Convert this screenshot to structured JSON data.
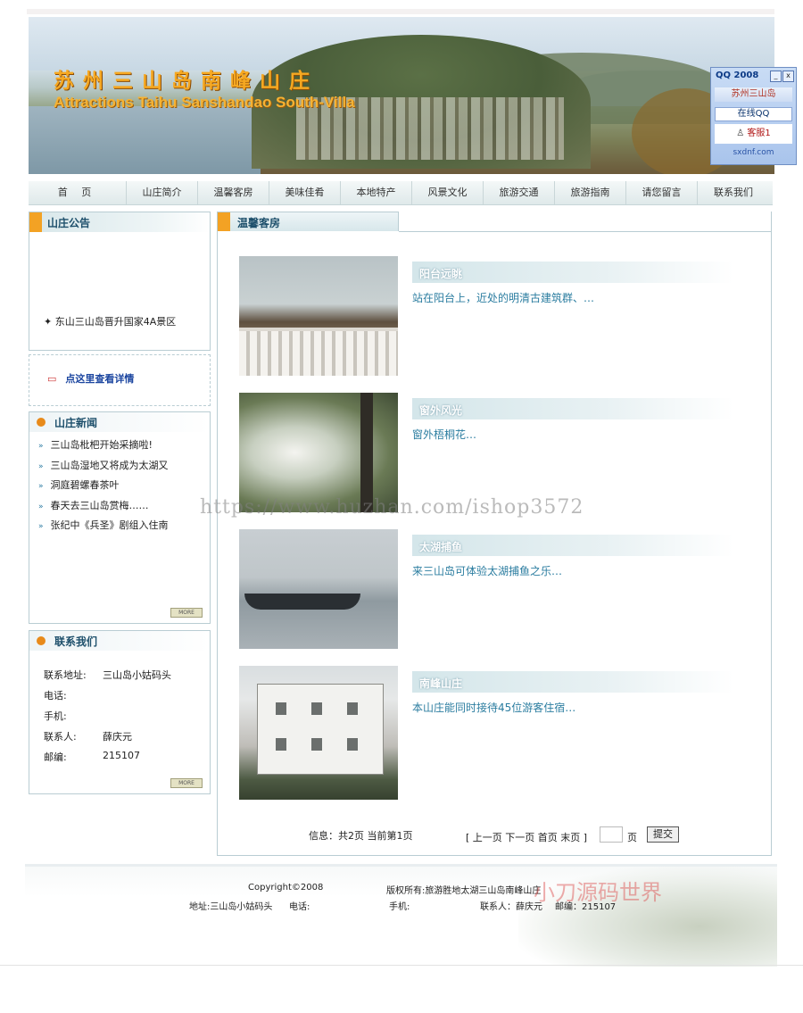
{
  "banner": {
    "title_cn": "苏州三山岛南峰山庄",
    "title_en": "Attractions Taihu Sanshandao South-Villa"
  },
  "nav": {
    "items": [
      "首 页",
      "山庄简介",
      "温馨客房",
      "美味佳肴",
      "本地特产",
      "风景文化",
      "旅游交通",
      "旅游指南",
      "请您留言",
      "联系我们"
    ]
  },
  "notice": {
    "title": "山庄公告",
    "items": [
      "东山三山岛晋升国家4A景区"
    ],
    "detail_link": "点这里查看详情"
  },
  "news": {
    "title": "山庄新闻",
    "items": [
      "三山岛枇杷开始采摘啦!",
      "三山岛湿地又将成为太湖又",
      "洞庭碧螺春茶叶",
      "春天去三山岛赏梅……",
      "张纪中《兵圣》剧组入住南"
    ],
    "more_label": "MORE"
  },
  "contact": {
    "title": "联系我们",
    "address_label": "联系地址:",
    "address": "三山岛小姑码头",
    "phone_label": "电话:",
    "mobile_label": "手机:",
    "person_label": "联系人:",
    "person": "薛庆元",
    "zip_label": "邮编:",
    "zip": "215107",
    "more_label": "MORE"
  },
  "main": {
    "title": "温馨客房",
    "rooms": [
      {
        "title": "阳台远眺",
        "desc": "站在阳台上，近处的明清古建筑群、…"
      },
      {
        "title": "窗外风光",
        "desc": "窗外梧桐花…"
      },
      {
        "title": "太湖捕鱼",
        "desc": "来三山岛可体验太湖捕鱼之乐…"
      },
      {
        "title": "南峰山庄",
        "desc": "本山庄能同时接待45位游客住宿…"
      }
    ],
    "pager": {
      "info": "信息：共2页   当前第1页",
      "links": "[ 上一页 下一页 首页 末页 ]",
      "unit": "页",
      "submit": "提交"
    }
  },
  "footer": {
    "copyright": "Copyright©2008",
    "owner": "版权所有:旅游胜地太湖三山岛南峰山庄",
    "address": "地址:三山岛小姑码头",
    "phone": "电话:",
    "mobile": "手机:",
    "contact": "联系人：薛庆元",
    "zip": "邮编：215107"
  },
  "qq": {
    "header": "QQ 2008",
    "min": "_",
    "close": "x",
    "name": "苏州三山岛",
    "online": "在线QQ",
    "kefu": "客服1",
    "site": "sxdnf.com"
  },
  "watermark": {
    "url": "https://www.huzhan.com/ishop3572",
    "brand": "小刀源码世界"
  }
}
